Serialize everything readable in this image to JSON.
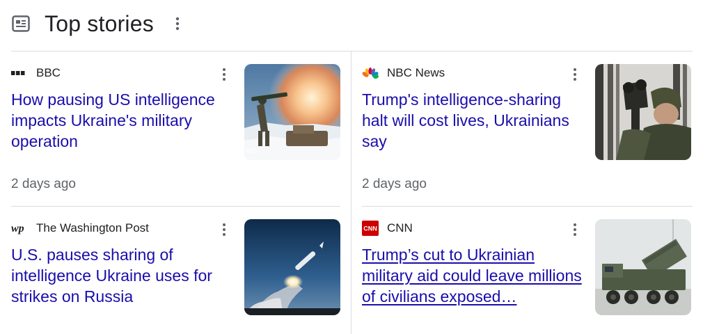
{
  "header": {
    "title": "Top stories",
    "icon": "newspaper-icon",
    "more_icon": "more-vert-icon"
  },
  "colors": {
    "headline": "#1a0dab",
    "secondary": "#5f6368",
    "divider": "#dadce0"
  },
  "stories": [
    {
      "source": "BBC",
      "logo": "bbc-logo-icon",
      "headline": "How pausing US intelligence impacts Ukraine's military operation",
      "time": "2 days ago",
      "thumbnail": "soldier-firing-rocket-launcher-image"
    },
    {
      "source": "NBC News",
      "logo": "nbc-peacock-logo-icon",
      "headline": "Trump's intelligence-sharing halt will cost lives, Ukrainians say",
      "time": "2 days ago",
      "thumbnail": "soldier-with-binoculars-image"
    },
    {
      "source": "The Washington Post",
      "logo": "wp-logo-icon",
      "headline": "U.S. pauses sharing of intelligence Ukraine uses for strikes on Russia",
      "thumbnail": "missile-launch-image"
    },
    {
      "source": "CNN",
      "logo": "cnn-logo-icon",
      "headline": "Trump’s cut to Ukrainian military aid could leave millions of civilians exposed…",
      "thumbnail": "patriot-missile-launcher-image"
    }
  ]
}
